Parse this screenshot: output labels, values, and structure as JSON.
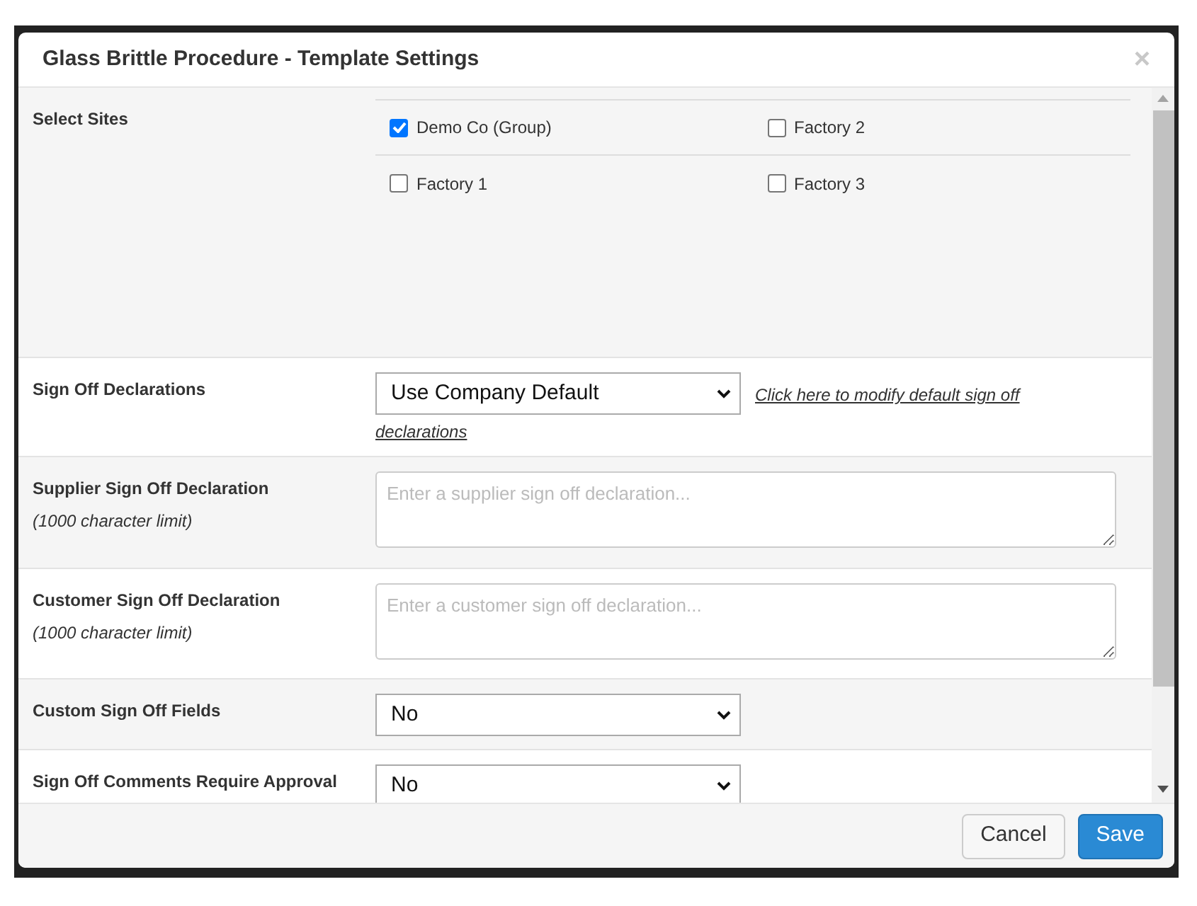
{
  "dialog": {
    "title": "Glass Brittle Procedure - Template Settings",
    "close": "×"
  },
  "rows": [
    {
      "kind": "checkboxes",
      "label": "Select Sites",
      "sites": [
        {
          "label": "Demo Co (Group)",
          "checked": true
        },
        {
          "label": "Factory 2",
          "checked": false
        },
        {
          "label": "Factory 1",
          "checked": false
        },
        {
          "label": "Factory 3",
          "checked": false
        }
      ]
    },
    {
      "kind": "select",
      "label": "Sign Off Declarations",
      "value": "Use Company Default",
      "link_lines": [
        "Click here to modify default sign off",
        "declarations"
      ]
    },
    {
      "kind": "textarea",
      "label": "Supplier Sign Off Declaration",
      "note": "(1000 character limit)",
      "placeholder": "Enter a supplier sign off declaration..."
    },
    {
      "kind": "textarea",
      "label": "Customer Sign Off Declaration",
      "note": "(1000 character limit)",
      "placeholder": "Enter a customer sign off declaration..."
    },
    {
      "kind": "select",
      "label": "Custom Sign Off Fields",
      "value": "No"
    },
    {
      "kind": "select",
      "label": "Sign Off Comments Require Approval",
      "value": "No"
    }
  ],
  "buttons": [
    {
      "label": "Cancel",
      "kind": "default"
    },
    {
      "label": "Save",
      "kind": "primary"
    }
  ]
}
